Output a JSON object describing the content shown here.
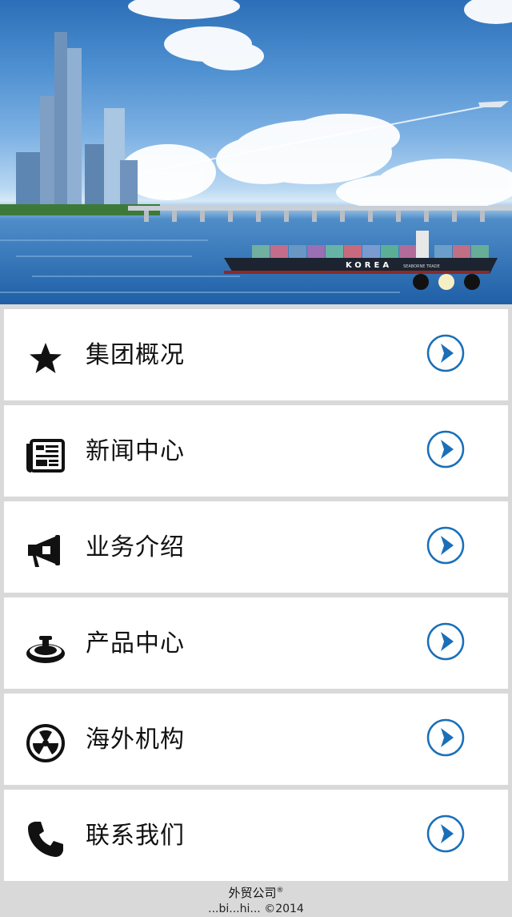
{
  "banner": {
    "ship_text": "KOREA",
    "ship_subtext": "SEABORNE TRADE",
    "slides": [
      {
        "active": false
      },
      {
        "active": true
      },
      {
        "active": false
      }
    ]
  },
  "menu": {
    "items": [
      {
        "label": "集团概况",
        "icon": "star-icon"
      },
      {
        "label": "新闻中心",
        "icon": "newspaper-icon"
      },
      {
        "label": "业务介绍",
        "icon": "megaphone-icon"
      },
      {
        "label": "产品中心",
        "icon": "product-dish-icon"
      },
      {
        "label": "海外机构",
        "icon": "radiation-icon"
      },
      {
        "label": "联系我们",
        "icon": "phone-icon"
      }
    ],
    "arrow_icon": "chevron-right-circle-icon"
  },
  "footer": {
    "company": "外贸公司",
    "mark": "®",
    "copyright": "...bi...hi... ©2014"
  },
  "colors": {
    "arrow_blue": "#1a6fb8",
    "active_dot": "#f7efc4"
  }
}
